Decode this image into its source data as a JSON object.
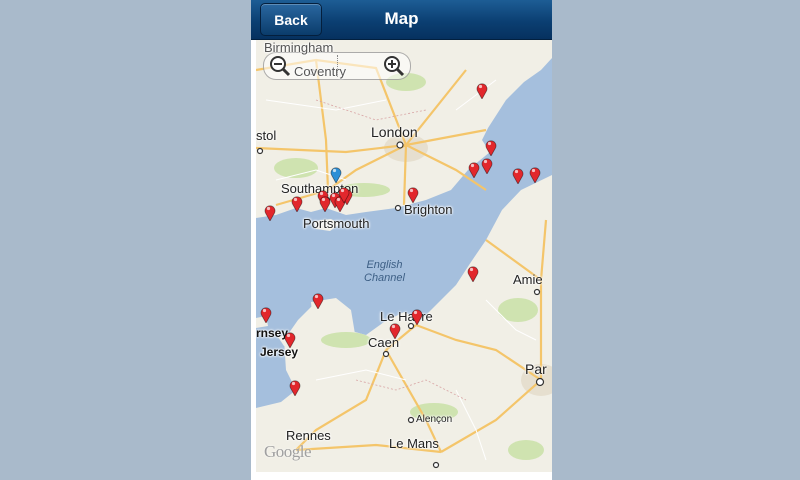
{
  "header": {
    "back_label": "Back",
    "title": "Map"
  },
  "colors": {
    "pin_red": "#e2272c",
    "pin_blue": "#2c8fd6",
    "sea": "#a5bfdd",
    "land": "#f1efe6",
    "header": "#0b3f72"
  },
  "map": {
    "labels": {
      "birmingham": "Birmingham",
      "coventry": "Coventry",
      "bristol": "stol",
      "london": "London",
      "southampton": "Southampton",
      "portsmouth": "Portsmouth",
      "brighton": "Brighton",
      "english_channel_1": "English",
      "english_channel_2": "Channel",
      "amiens": "Amie",
      "le_havre": "Le Havre",
      "caen": "Caen",
      "guernsey": "rnsey",
      "jersey": "Jersey",
      "paris": "Par",
      "alencon": "Alençon",
      "rennes": "Rennes",
      "le_mans": "Le Mans"
    },
    "attribution": "Google",
    "marker_count": 22,
    "current_location_markers": 1
  }
}
